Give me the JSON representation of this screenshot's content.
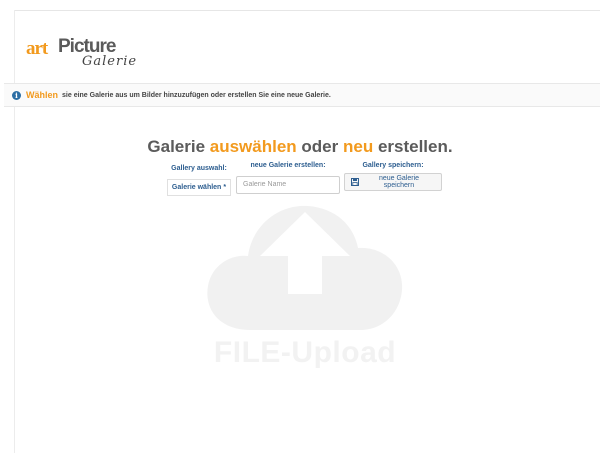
{
  "logo": {
    "art": "art",
    "picture": "Picture",
    "galerie": "Galerie"
  },
  "info": {
    "icon": "info-icon",
    "highlight": "Wählen",
    "text": "sie eine Galerie aus um Bilder hinzuzufügen oder erstellen Sie eine neue Galerie."
  },
  "heading": {
    "part1": "Galerie ",
    "highlight1": "auswählen",
    "part2": " oder ",
    "highlight2": "neu",
    "part3": " erstellen."
  },
  "form": {
    "gallery_select_label": "Gallery auswahl:",
    "gallery_select_value": "Galerie wählen",
    "gallery_select_required": "*",
    "new_gallery_label": "neue Galerie erstellen:",
    "new_gallery_placeholder": "Galerie Name",
    "save_label": "Gallery speichern:",
    "save_button": "neue Galerie speichern"
  },
  "upload": {
    "icon": "cloud-upload-icon",
    "part1": "FILE",
    "part2": "-Upload"
  },
  "colors": {
    "accent": "#f29a1e",
    "link": "#2c5d8f",
    "text": "#5b5b5b"
  }
}
